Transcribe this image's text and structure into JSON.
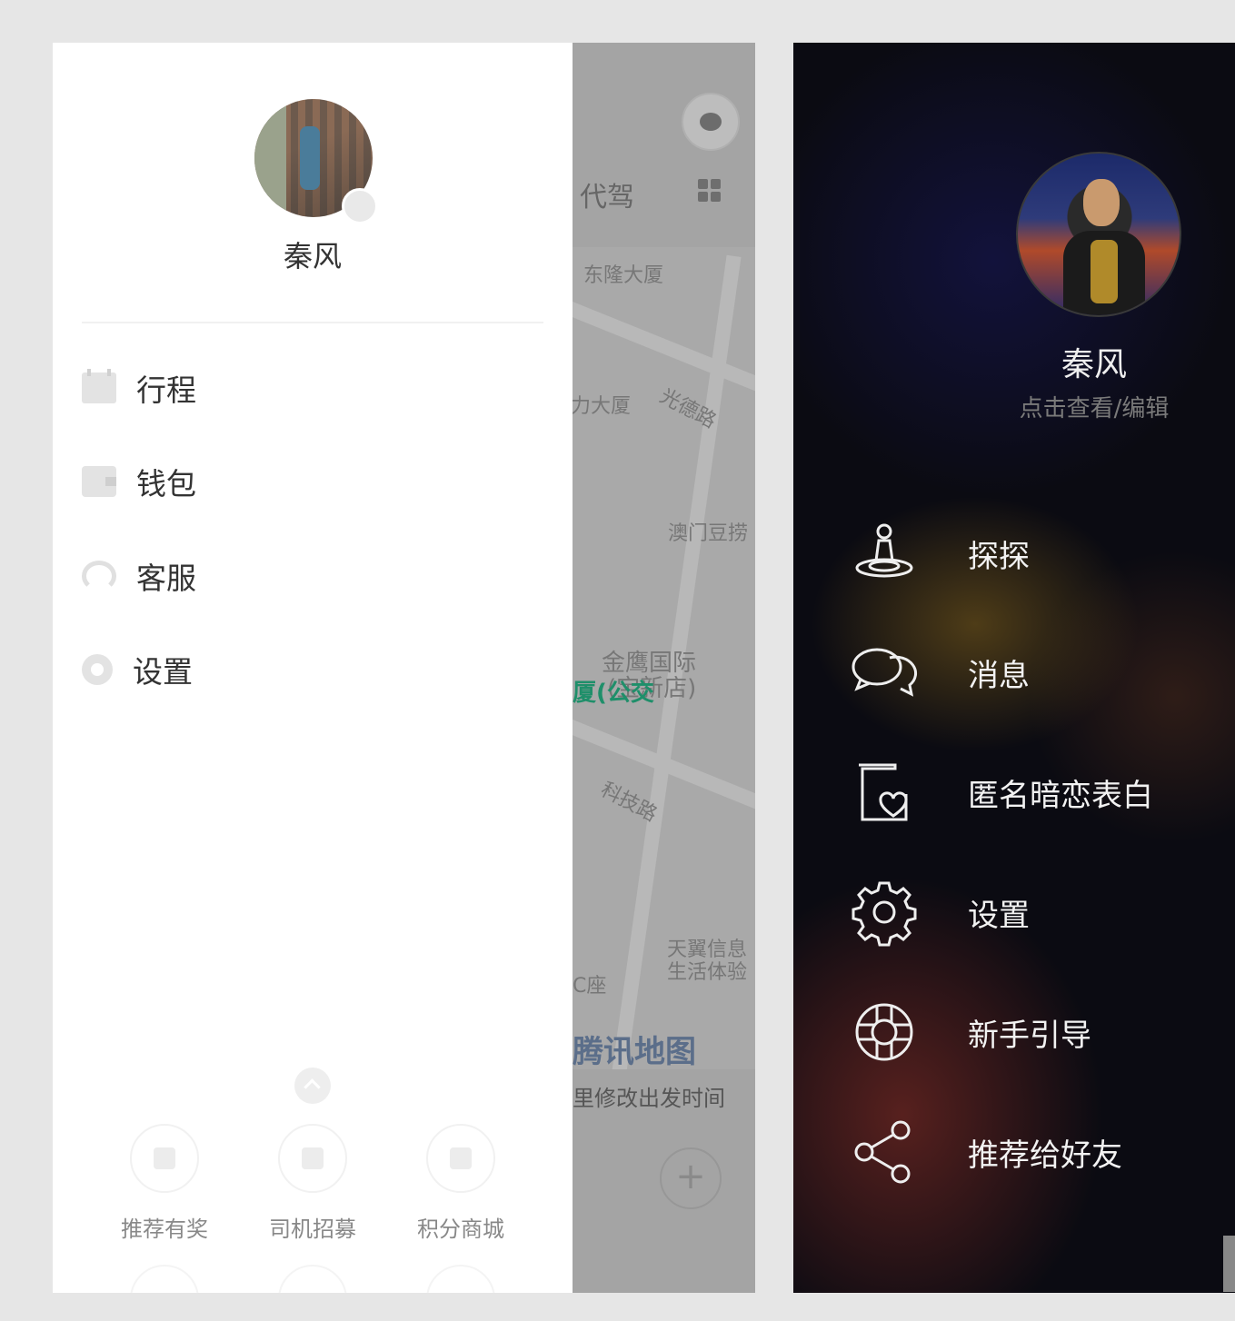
{
  "left_phone": {
    "user": {
      "name": "秦风"
    },
    "menu": [
      {
        "icon": "calendar-icon",
        "label": "行程"
      },
      {
        "icon": "wallet-icon",
        "label": "钱包"
      },
      {
        "icon": "headset-icon",
        "label": "客服"
      },
      {
        "icon": "gear-icon",
        "label": "设置"
      }
    ],
    "bottom": [
      {
        "icon": "gift-icon",
        "label": "推荐有奖"
      },
      {
        "icon": "driver-icon",
        "label": "司机招募"
      },
      {
        "icon": "cart-icon",
        "label": "积分商城"
      }
    ],
    "map": {
      "tab": "代驾",
      "labels": [
        "东隆大厦",
        "力大厦",
        "光德路",
        "澳门豆捞",
        "金鹰国际",
        "(宝新店)",
        "厦(公交",
        "科技路",
        "天翼信息",
        "生活体验",
        "C座"
      ],
      "logo": "腾讯地图",
      "hint": "里修改出发时间",
      "plus": "+"
    }
  },
  "right_phone": {
    "user": {
      "name": "秦风",
      "edit": "点击查看/编辑"
    },
    "menu": [
      {
        "icon": "location-pin-icon",
        "label": "探探"
      },
      {
        "icon": "chat-bubbles-icon",
        "label": "消息"
      },
      {
        "icon": "heart-book-icon",
        "label": "匿名暗恋表白"
      },
      {
        "icon": "gear-icon",
        "label": "设置"
      },
      {
        "icon": "lifebuoy-icon",
        "label": "新手引导"
      },
      {
        "icon": "share-icon",
        "label": "推荐给好友"
      }
    ]
  }
}
